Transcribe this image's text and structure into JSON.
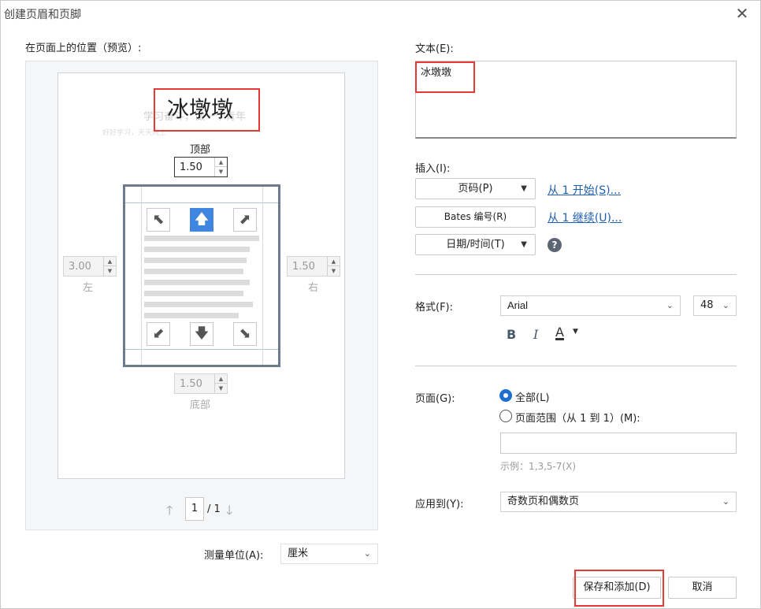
{
  "window": {
    "title": "创建页眉和页脚",
    "close_glyph": "✕"
  },
  "preview": {
    "label": "在页面上的位置（预览）:",
    "header_text": "冰墩墩",
    "ghost_line1": "学习奋斗，做一个青年",
    "ghost_line2": "好好学习，天天向上",
    "top_label": "顶部",
    "top_value": "1.50",
    "left_label": "左",
    "left_value": "3.00",
    "right_label": "右",
    "right_value": "1.50",
    "bottom_label": "底部",
    "bottom_value": "1.50",
    "page_current": "1",
    "page_total": "/ 1",
    "up_glyph": "🡑",
    "down_glyph": "🡓"
  },
  "arrows": {
    "nw": "⬉",
    "n": "🡅",
    "ne": "⬈",
    "sw": "⬋",
    "s": "🡇",
    "se": "⬊"
  },
  "units": {
    "label": "测量单位(A):",
    "value": "厘米"
  },
  "text_section": {
    "label": "文本(E):",
    "value": "冰墩墩"
  },
  "insert": {
    "label": "插入(I):",
    "page_number_button": "页码(P)",
    "start_from_link": "从 1 开始(S)...",
    "bates_button": "Bates 编号(R)",
    "continue_from_link": "从 1 继续(U)...",
    "datetime_button": "日期/时间(T)",
    "help_glyph": "?"
  },
  "format": {
    "label": "格式(F):",
    "font": "Arial",
    "size": "48",
    "bold": "B",
    "italic": "I",
    "color_glyph": "A"
  },
  "pages": {
    "label": "页面(G):",
    "all_option": "全部(L)",
    "range_option": "页面范围（从 1 到 1）(M):",
    "range_input": "",
    "example": "示例：1,3,5-7(X)"
  },
  "apply": {
    "label": "应用到(Y):",
    "value": "奇数页和偶数页"
  },
  "footer": {
    "save_add": "保存和添加(D)",
    "cancel": "取消"
  },
  "colors": {
    "accent": "#3f86e0",
    "highlight": "#e53935",
    "link": "#1f5fb0"
  }
}
